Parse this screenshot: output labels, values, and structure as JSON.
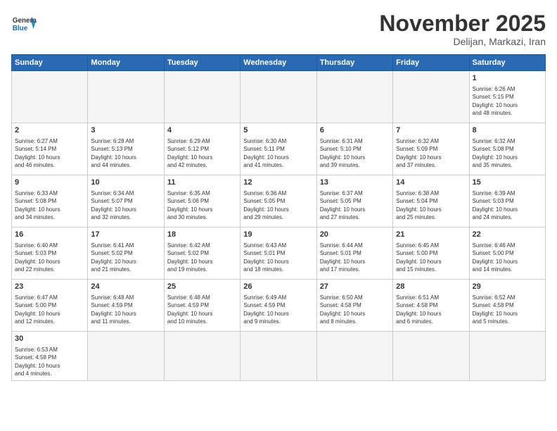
{
  "header": {
    "logo_general": "General",
    "logo_blue": "Blue",
    "month_title": "November 2025",
    "location": "Delijan, Markazi, Iran"
  },
  "weekdays": [
    "Sunday",
    "Monday",
    "Tuesday",
    "Wednesday",
    "Thursday",
    "Friday",
    "Saturday"
  ],
  "weeks": [
    [
      {
        "day": "",
        "info": ""
      },
      {
        "day": "",
        "info": ""
      },
      {
        "day": "",
        "info": ""
      },
      {
        "day": "",
        "info": ""
      },
      {
        "day": "",
        "info": ""
      },
      {
        "day": "",
        "info": ""
      },
      {
        "day": "1",
        "info": "Sunrise: 6:26 AM\nSunset: 5:15 PM\nDaylight: 10 hours\nand 48 minutes."
      }
    ],
    [
      {
        "day": "2",
        "info": "Sunrise: 6:27 AM\nSunset: 5:14 PM\nDaylight: 10 hours\nand 46 minutes."
      },
      {
        "day": "3",
        "info": "Sunrise: 6:28 AM\nSunset: 5:13 PM\nDaylight: 10 hours\nand 44 minutes."
      },
      {
        "day": "4",
        "info": "Sunrise: 6:29 AM\nSunset: 5:12 PM\nDaylight: 10 hours\nand 42 minutes."
      },
      {
        "day": "5",
        "info": "Sunrise: 6:30 AM\nSunset: 5:11 PM\nDaylight: 10 hours\nand 41 minutes."
      },
      {
        "day": "6",
        "info": "Sunrise: 6:31 AM\nSunset: 5:10 PM\nDaylight: 10 hours\nand 39 minutes."
      },
      {
        "day": "7",
        "info": "Sunrise: 6:32 AM\nSunset: 5:09 PM\nDaylight: 10 hours\nand 37 minutes."
      },
      {
        "day": "8",
        "info": "Sunrise: 6:32 AM\nSunset: 5:08 PM\nDaylight: 10 hours\nand 35 minutes."
      }
    ],
    [
      {
        "day": "9",
        "info": "Sunrise: 6:33 AM\nSunset: 5:08 PM\nDaylight: 10 hours\nand 34 minutes."
      },
      {
        "day": "10",
        "info": "Sunrise: 6:34 AM\nSunset: 5:07 PM\nDaylight: 10 hours\nand 32 minutes."
      },
      {
        "day": "11",
        "info": "Sunrise: 6:35 AM\nSunset: 5:06 PM\nDaylight: 10 hours\nand 30 minutes."
      },
      {
        "day": "12",
        "info": "Sunrise: 6:36 AM\nSunset: 5:05 PM\nDaylight: 10 hours\nand 29 minutes."
      },
      {
        "day": "13",
        "info": "Sunrise: 6:37 AM\nSunset: 5:05 PM\nDaylight: 10 hours\nand 27 minutes."
      },
      {
        "day": "14",
        "info": "Sunrise: 6:38 AM\nSunset: 5:04 PM\nDaylight: 10 hours\nand 25 minutes."
      },
      {
        "day": "15",
        "info": "Sunrise: 6:39 AM\nSunset: 5:03 PM\nDaylight: 10 hours\nand 24 minutes."
      }
    ],
    [
      {
        "day": "16",
        "info": "Sunrise: 6:40 AM\nSunset: 5:03 PM\nDaylight: 10 hours\nand 22 minutes."
      },
      {
        "day": "17",
        "info": "Sunrise: 6:41 AM\nSunset: 5:02 PM\nDaylight: 10 hours\nand 21 minutes."
      },
      {
        "day": "18",
        "info": "Sunrise: 6:42 AM\nSunset: 5:02 PM\nDaylight: 10 hours\nand 19 minutes."
      },
      {
        "day": "19",
        "info": "Sunrise: 6:43 AM\nSunset: 5:01 PM\nDaylight: 10 hours\nand 18 minutes."
      },
      {
        "day": "20",
        "info": "Sunrise: 6:44 AM\nSunset: 5:01 PM\nDaylight: 10 hours\nand 17 minutes."
      },
      {
        "day": "21",
        "info": "Sunrise: 6:45 AM\nSunset: 5:00 PM\nDaylight: 10 hours\nand 15 minutes."
      },
      {
        "day": "22",
        "info": "Sunrise: 6:46 AM\nSunset: 5:00 PM\nDaylight: 10 hours\nand 14 minutes."
      }
    ],
    [
      {
        "day": "23",
        "info": "Sunrise: 6:47 AM\nSunset: 5:00 PM\nDaylight: 10 hours\nand 12 minutes."
      },
      {
        "day": "24",
        "info": "Sunrise: 6:48 AM\nSunset: 4:59 PM\nDaylight: 10 hours\nand 11 minutes."
      },
      {
        "day": "25",
        "info": "Sunrise: 6:48 AM\nSunset: 4:59 PM\nDaylight: 10 hours\nand 10 minutes."
      },
      {
        "day": "26",
        "info": "Sunrise: 6:49 AM\nSunset: 4:59 PM\nDaylight: 10 hours\nand 9 minutes."
      },
      {
        "day": "27",
        "info": "Sunrise: 6:50 AM\nSunset: 4:58 PM\nDaylight: 10 hours\nand 8 minutes."
      },
      {
        "day": "28",
        "info": "Sunrise: 6:51 AM\nSunset: 4:58 PM\nDaylight: 10 hours\nand 6 minutes."
      },
      {
        "day": "29",
        "info": "Sunrise: 6:52 AM\nSunset: 4:58 PM\nDaylight: 10 hours\nand 5 minutes."
      }
    ],
    [
      {
        "day": "30",
        "info": "Sunrise: 6:53 AM\nSunset: 4:58 PM\nDaylight: 10 hours\nand 4 minutes."
      },
      {
        "day": "",
        "info": ""
      },
      {
        "day": "",
        "info": ""
      },
      {
        "day": "",
        "info": ""
      },
      {
        "day": "",
        "info": ""
      },
      {
        "day": "",
        "info": ""
      },
      {
        "day": "",
        "info": ""
      }
    ]
  ]
}
